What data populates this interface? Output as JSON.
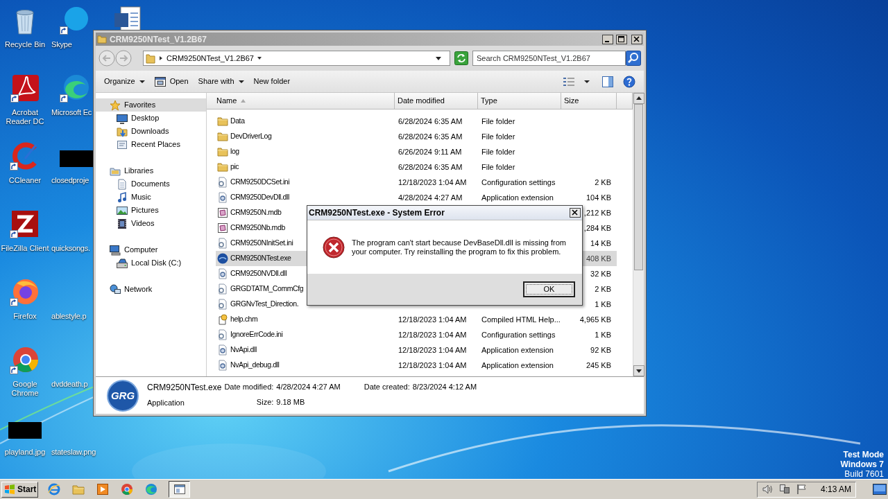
{
  "desktop": {
    "icons": [
      {
        "kind": "recycle",
        "label": "Recycle Bin"
      },
      {
        "kind": "acrobat",
        "label": "Acrobat Reader DC"
      },
      {
        "kind": "ccleaner",
        "label": "CCleaner"
      },
      {
        "kind": "filezilla",
        "label": "FileZilla Client"
      },
      {
        "kind": "firefox",
        "label": "Firefox"
      },
      {
        "kind": "chrome",
        "label": "Google Chrome"
      },
      {
        "kind": "thumbnail",
        "label": "playland.jpg"
      },
      {
        "kind": "skype",
        "label": "Skype"
      },
      {
        "kind": "edge",
        "label": "Microsoft Ec"
      },
      {
        "kind": "thumbnail",
        "label": "closedproje"
      },
      {
        "kind": "covered",
        "label": "quicksongs."
      },
      {
        "kind": "covered",
        "label": "ablestyle.p"
      },
      {
        "kind": "covered",
        "label": "dvddeath.p"
      },
      {
        "kind": "covered",
        "label": "stateslaw.png"
      },
      {
        "kind": "word"
      }
    ],
    "os_notice": [
      {
        "text": "Test Mode",
        "bold": true
      },
      {
        "text": "Windows 7",
        "bold": true
      },
      {
        "text": "Build 7601",
        "bold": false
      }
    ]
  },
  "explorer": {
    "title": "CRM9250NTest_V1.2B67",
    "address": "CRM9250NTest_V1.2B67",
    "search": {
      "placeholder": "Search CRM9250NTest_V1.2B67"
    },
    "toolbar": [
      {
        "kind": "menu",
        "label": "Organize"
      },
      {
        "kind": "open",
        "label": "Open"
      },
      {
        "kind": "menu",
        "label": "Share with"
      },
      {
        "kind": "plain",
        "label": "New folder"
      }
    ],
    "nav": [
      {
        "kind": "star",
        "label": "Favorites",
        "selected": true,
        "children": [
          {
            "kind": "desktop",
            "label": "Desktop",
            "selected": false
          },
          {
            "kind": "downloads",
            "label": "Downloads",
            "selected": false
          },
          {
            "kind": "recent",
            "label": "Recent Places",
            "selected": false
          }
        ]
      },
      {
        "kind": "libraries",
        "label": "Libraries",
        "selected": false,
        "children": [
          {
            "kind": "documents",
            "label": "Documents",
            "selected": false
          },
          {
            "kind": "music",
            "label": "Music",
            "selected": false
          },
          {
            "kind": "pictures",
            "label": "Pictures",
            "selected": false
          },
          {
            "kind": "videos",
            "label": "Videos",
            "selected": false
          }
        ]
      },
      {
        "kind": "computer",
        "label": "Computer",
        "selected": false,
        "children": [
          {
            "kind": "disk",
            "label": "Local Disk (C:)",
            "selected": false
          }
        ]
      },
      {
        "kind": "network",
        "label": "Network",
        "selected": false
      }
    ],
    "columns": [
      {
        "label": "Name",
        "sorted": true
      },
      {
        "label": "Date modified",
        "sorted": false
      },
      {
        "label": "Type",
        "sorted": false
      },
      {
        "label": "Size",
        "sorted": false
      }
    ],
    "rows": [
      {
        "name": "Data",
        "date": "6/28/2024 6:35 AM",
        "type": "File folder",
        "kind": "folder",
        "selected": false
      },
      {
        "name": "DevDriverLog",
        "date": "6/28/2024 6:35 AM",
        "type": "File folder",
        "kind": "folder",
        "selected": false
      },
      {
        "name": "log",
        "date": "6/26/2024 9:11 AM",
        "type": "File folder",
        "kind": "folder",
        "selected": false
      },
      {
        "name": "pic",
        "date": "6/28/2024 6:35 AM",
        "type": "File folder",
        "kind": "folder",
        "selected": false
      },
      {
        "name": "CRM9250DCSet.ini",
        "date": "12/18/2023 1:04 AM",
        "type": "Configuration settings",
        "size": "2 KB",
        "kind": "ini",
        "selected": false
      },
      {
        "name": "CRM9250DevDll.dll",
        "date": "4/28/2024 4:27 AM",
        "type": "Application extension",
        "size": "104 KB",
        "kind": "dll",
        "selected": false
      },
      {
        "name": "CRM9250N.mdb",
        "size": ",212 KB",
        "kind": "mdb",
        "selected": false
      },
      {
        "name": "CRM9250Nb.mdb",
        "size": ",284 KB",
        "kind": "mdb",
        "selected": false
      },
      {
        "name": "CRM9250NInitSet.ini",
        "size": "14 KB",
        "kind": "ini",
        "selected": false
      },
      {
        "name": "CRM9250NTest.exe",
        "size": "408 KB",
        "kind": "exe",
        "selected": true
      },
      {
        "name": "CRM9250NVDll.dll",
        "size": "32 KB",
        "kind": "dll",
        "selected": false
      },
      {
        "name": "GRGDTATM_CommCfg",
        "size": "2 KB",
        "kind": "ini",
        "selected": false
      },
      {
        "name": "GRGNvTest_Direction.",
        "size": "1 KB",
        "kind": "ini",
        "selected": false
      },
      {
        "name": "help.chm",
        "date": "12/18/2023 1:04 AM",
        "type": "Compiled HTML Help...",
        "size": "4,965 KB",
        "kind": "chm",
        "selected": false
      },
      {
        "name": "IgnoreErrCode.ini",
        "date": "12/18/2023 1:04 AM",
        "type": "Configuration settings",
        "size": "1 KB",
        "kind": "ini",
        "selected": false
      },
      {
        "name": "NvApi.dll",
        "date": "12/18/2023 1:04 AM",
        "type": "Application extension",
        "size": "92 KB",
        "kind": "dll",
        "selected": false
      },
      {
        "name": "NvApi_debug.dll",
        "date": "12/18/2023 1:04 AM",
        "type": "Application extension",
        "size": "245 KB",
        "kind": "dll",
        "selected": false
      }
    ],
    "details": {
      "logo": "GRG",
      "name": "CRM9250NTest.exe",
      "type": "Application",
      "fields": [
        {
          "label": "Date modified:",
          "value": "4/28/2024 4:27 AM"
        },
        {
          "label": "Size:",
          "value": "9.18 MB"
        },
        {
          "label": "Date created:",
          "value": "8/23/2024 4:12 AM"
        }
      ]
    }
  },
  "dialog": {
    "title": "CRM9250NTest.exe - System Error",
    "message": "The program can't start because DevBaseDll.dll is missing from your computer. Try reinstalling the program to fix this problem.",
    "button": "OK"
  },
  "taskbar": {
    "start": "Start",
    "quick_launch": [
      {
        "kind": "ie"
      },
      {
        "kind": "folder"
      },
      {
        "kind": "media"
      },
      {
        "kind": "chrome"
      },
      {
        "kind": "edge"
      }
    ],
    "tasks": [
      {
        "kind": "window",
        "selected": true
      }
    ],
    "clock": "4:13 AM"
  }
}
